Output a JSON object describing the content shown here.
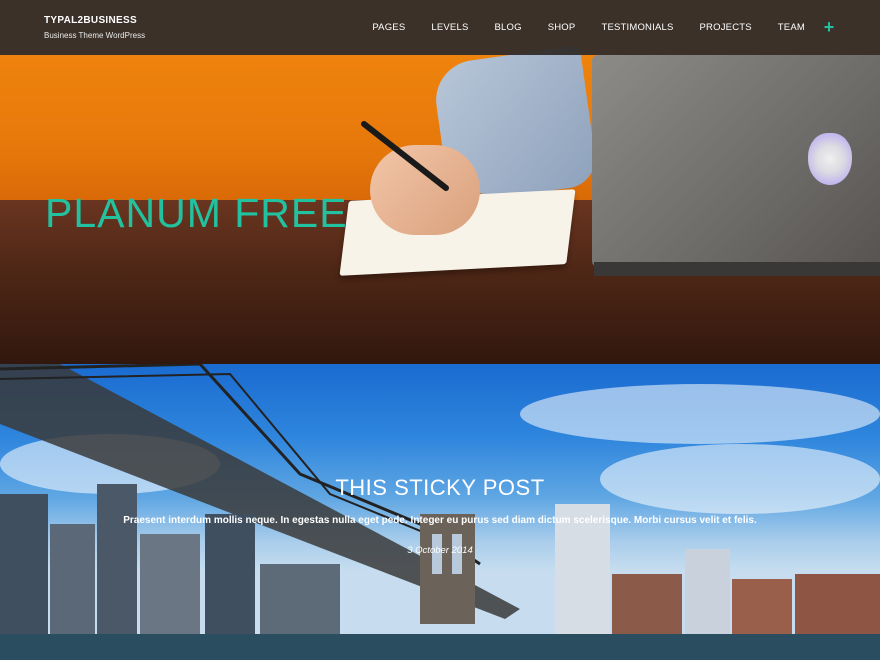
{
  "header": {
    "site_title": "TYPAL2BUSINESS",
    "tagline": "Business Theme WordPress",
    "nav": [
      "PAGES",
      "LEVELS",
      "BLOG",
      "SHOP",
      "TESTIMONIALS",
      "PROJECTS",
      "TEAM"
    ],
    "more_icon": "plus-icon",
    "accent_color": "#22c2a0"
  },
  "hero": {
    "title": "PLANUM FREE"
  },
  "sticky_post": {
    "title": "THIS STICKY POST",
    "excerpt": "Praesent interdum mollis neque. In egestas nulla eget pede. Integer eu purus sed diam dictum scelerisque. Morbi cursus velit et felis.",
    "date": "3 October 2014"
  }
}
